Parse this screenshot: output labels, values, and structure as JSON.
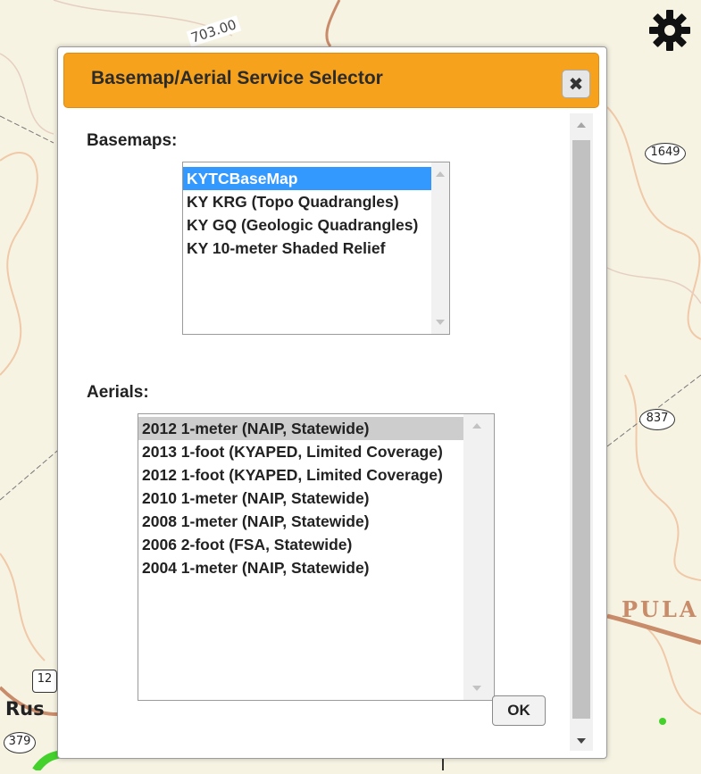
{
  "map": {
    "labels": {
      "road_top": "703.00",
      "shield_1649": "1649",
      "shield_837": "837",
      "shield_12": "12",
      "shield_379": "379",
      "county": "PULA",
      "town": "Rus"
    }
  },
  "dialog": {
    "title": "Basemap/Aerial Service Selector",
    "close_label": "✖",
    "basemaps": {
      "label": "Basemaps:",
      "options": [
        "KYTCBaseMap",
        "KY KRG (Topo Quadrangles)",
        "KY GQ (Geologic Quadrangles)",
        "KY 10-meter Shaded Relief"
      ]
    },
    "aerials": {
      "label": "Aerials:",
      "options": [
        "2012 1-meter (NAIP, Statewide)",
        "2013 1-foot (KYAPED, Limited Coverage)",
        "2012 1-foot (KYAPED, Limited Coverage)",
        "2010 1-meter (NAIP, Statewide)",
        "2008 1-meter (NAIP, Statewide)",
        "2006 2-foot (FSA, Statewide)",
        "2004 1-meter (NAIP, Statewide)"
      ]
    },
    "ok_label": "OK"
  },
  "colors": {
    "title_bar": "#f7a21c",
    "selected_basemap": "#3399ff",
    "selected_aerial": "#cdcdcd",
    "map_background": "#f6f3e3"
  },
  "icons": {
    "settings": "gear-icon"
  }
}
